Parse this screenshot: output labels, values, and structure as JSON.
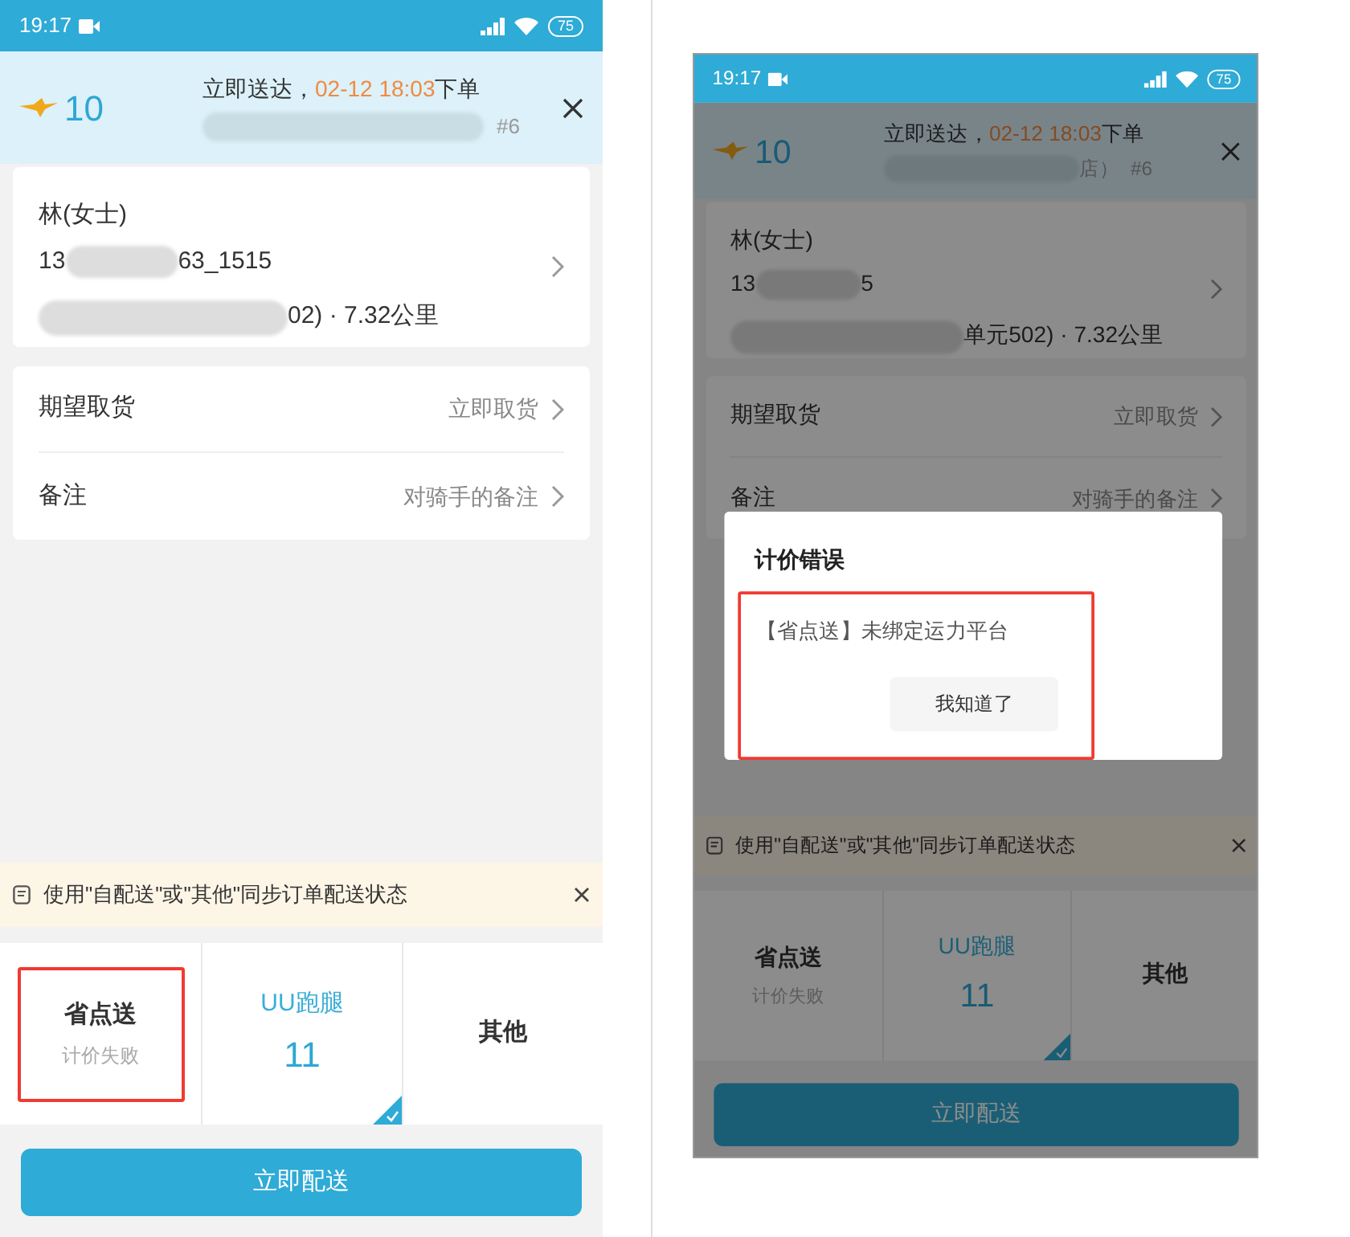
{
  "screens": [
    {
      "status_bar": {
        "time": "19:17",
        "battery": "75"
      },
      "order_header": {
        "number": "10",
        "line_prefix": "立即送达，",
        "order_time": "02-12 18:03",
        "line_suffix": "下单",
        "order_tag": "#6"
      },
      "customer": {
        "name": "林(女士)",
        "phone_start": "13",
        "phone_end": "63_1515",
        "address_end": "02) · 7.32公里"
      },
      "settings": [
        {
          "label": "期望取货",
          "value": "立即取货"
        },
        {
          "label": "备注",
          "value": "对骑手的备注"
        }
      ],
      "notice": "使用\"自配送\"或\"其他\"同步订单配送状态",
      "carriers": [
        {
          "name": "省点送",
          "note": "计价失败",
          "selected": false,
          "highlighted": true
        },
        {
          "name": "UU跑腿",
          "price": "11",
          "selected": true,
          "highlighted": false
        },
        {
          "name": "其他",
          "selected": false,
          "highlighted": false
        }
      ],
      "primary_button": "立即配送",
      "dimmed": false
    },
    {
      "status_bar": {
        "time": "19:17",
        "battery": "75"
      },
      "order_header": {
        "number": "10",
        "line_prefix": "立即送达，",
        "order_time": "02-12 18:03",
        "line_suffix": "下单",
        "store_fragment": "店）",
        "order_tag": "#6"
      },
      "customer": {
        "name": "林(女士)",
        "phone_start": "13",
        "phone_end": "5",
        "address_end": "单元502) · 7.32公里"
      },
      "settings": [
        {
          "label": "期望取货",
          "value": "立即取货"
        },
        {
          "label": "备注",
          "value": "对骑手的备注"
        }
      ],
      "notice": "使用\"自配送\"或\"其他\"同步订单配送状态",
      "carriers": [
        {
          "name": "省点送",
          "note": "计价失败",
          "selected": false,
          "highlighted": false
        },
        {
          "name": "UU跑腿",
          "price": "11",
          "selected": true,
          "highlighted": false
        },
        {
          "name": "其他",
          "selected": false,
          "highlighted": false
        }
      ],
      "primary_button": "立即配送",
      "dimmed": true,
      "dialog": {
        "title": "计价错误",
        "message": "【省点送】未绑定运力平台",
        "button": "我知道了",
        "highlighted": true
      }
    }
  ]
}
